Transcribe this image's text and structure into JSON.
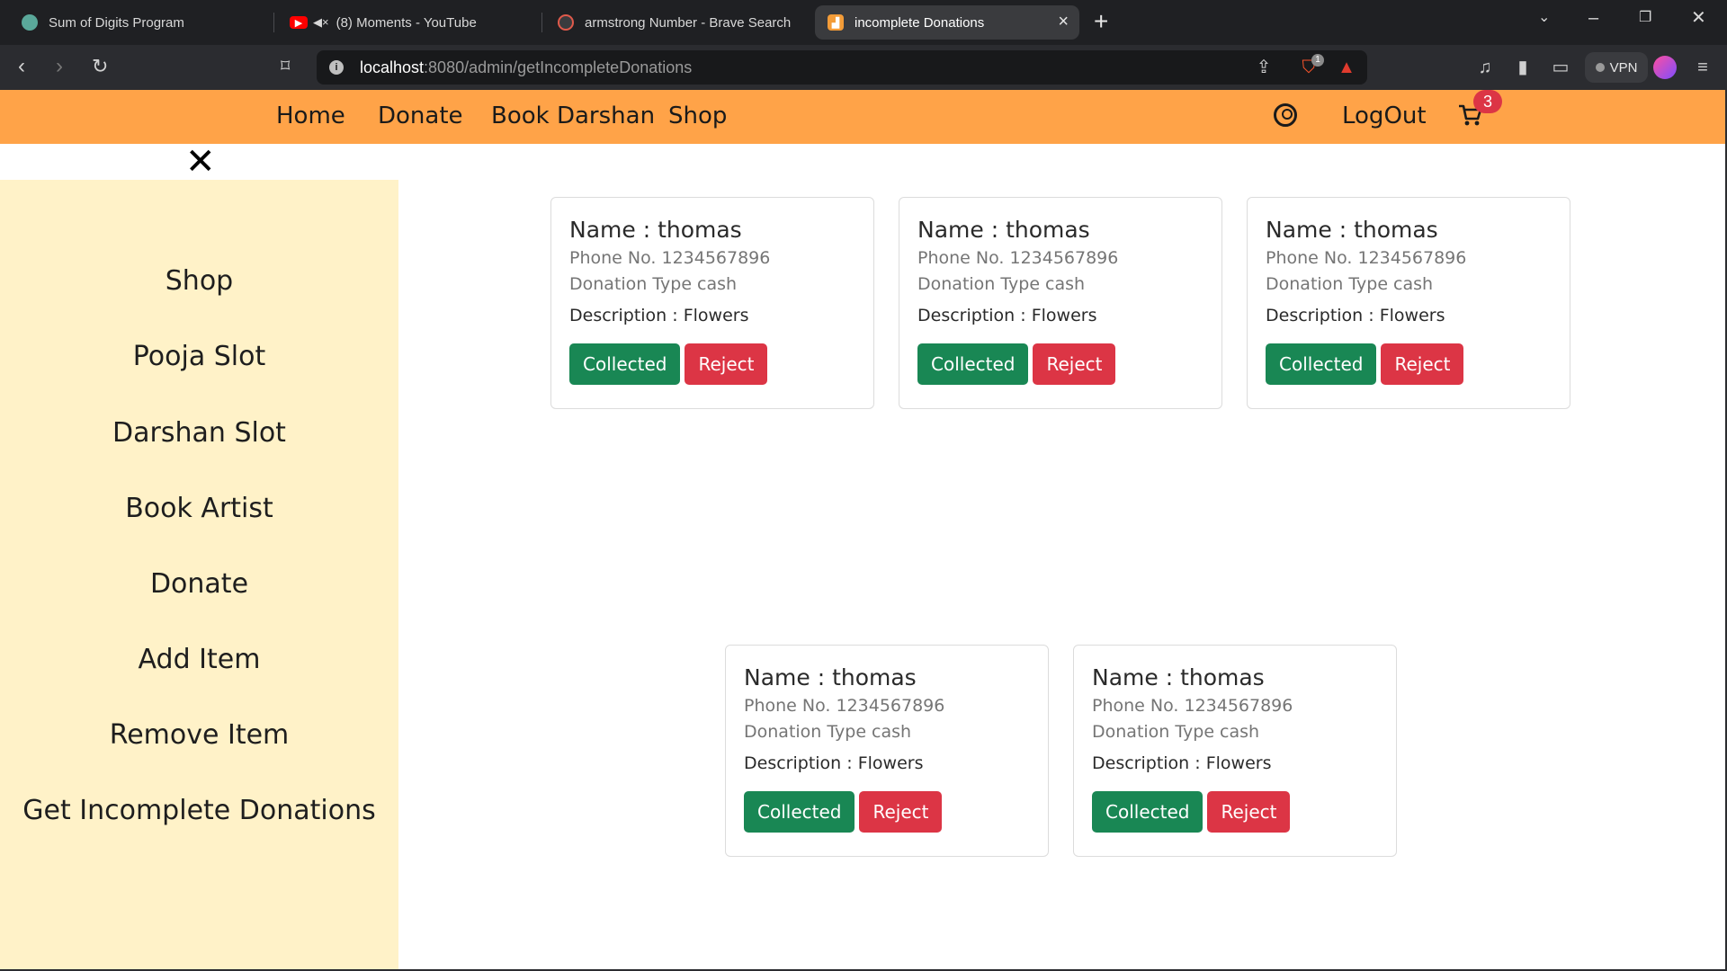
{
  "browser": {
    "tabs": [
      {
        "title": "Sum of Digits Program",
        "active": false
      },
      {
        "title": "(8) Moments - YouTube",
        "active": false
      },
      {
        "title": "armstrong Number - Brave Search",
        "active": false
      },
      {
        "title": "incomplete Donations",
        "active": true
      }
    ],
    "url_host": "localhost",
    "url_path": ":8080/admin/getIncompleteDonations",
    "shields_count": "1",
    "vpn_label": "VPN"
  },
  "nav": {
    "home": "Home",
    "donate": "Donate",
    "book_darshan": "Book Darshan",
    "shop": "Shop",
    "logout": "LogOut",
    "cart_count": "3"
  },
  "sidebar": {
    "items": [
      "Shop",
      "Pooja Slot",
      "Darshan Slot",
      "Book Artist",
      "Donate",
      "Add Item",
      "Remove Item",
      "Get Incomplete Donations"
    ]
  },
  "donations": [
    {
      "name": "Name : thomas",
      "phone": "Phone No. 1234567896",
      "type": "Donation Type cash",
      "description": "Description : Flowers",
      "collected_label": "Collected",
      "reject_label": "Reject"
    },
    {
      "name": "Name : thomas",
      "phone": "Phone No. 1234567896",
      "type": "Donation Type cash",
      "description": "Description : Flowers",
      "collected_label": "Collected",
      "reject_label": "Reject"
    },
    {
      "name": "Name : thomas",
      "phone": "Phone No. 1234567896",
      "type": "Donation Type cash",
      "description": "Description : Flowers",
      "collected_label": "Collected",
      "reject_label": "Reject"
    },
    {
      "name": "Name : thomas",
      "phone": "Phone No. 1234567896",
      "type": "Donation Type cash",
      "description": "Description : Flowers",
      "collected_label": "Collected",
      "reject_label": "Reject"
    },
    {
      "name": "Name : thomas",
      "phone": "Phone No. 1234567896",
      "type": "Donation Type cash",
      "description": "Description : Flowers",
      "collected_label": "Collected",
      "reject_label": "Reject"
    }
  ],
  "colors": {
    "navbar": "#ffa348",
    "sidebar": "#fff2c8",
    "collected_button": "#198754",
    "reject_button": "#dc3545"
  },
  "icons": {
    "close": "close-icon",
    "user": "user-circle-icon",
    "cart": "cart-icon"
  }
}
